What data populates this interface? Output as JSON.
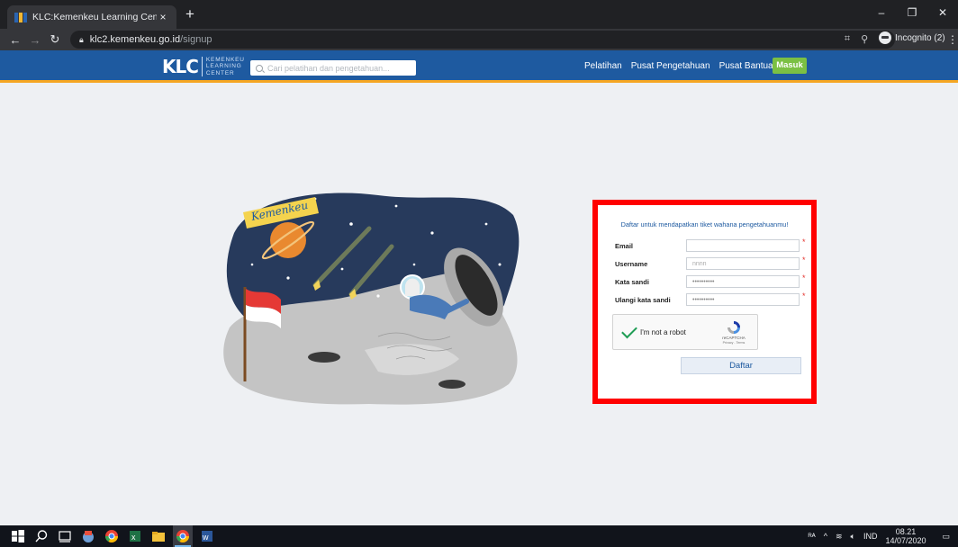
{
  "browser": {
    "tab_title": "KLC:Kemenkeu Learning Center",
    "tab_close": "×",
    "new_tab": "+",
    "url_host": "klc2.kemenkeu.go.id",
    "url_path": "/signup",
    "incognito_label": "Incognito (2)",
    "window_controls": {
      "minimize": "–",
      "restore": "❐",
      "close": "✕"
    }
  },
  "site": {
    "logo_mark": "KLC",
    "logo_lines": [
      "KEMENKEU",
      "LEARNING",
      "CENTER"
    ],
    "search_placeholder": "Cari pelatihan dan pengetahuan...",
    "nav": [
      "Pelatihan",
      "Pusat Pengetahuan",
      "Pusat Bantuan"
    ],
    "login_button": "Masuk"
  },
  "illustration": {
    "banner_text": "Kemenkeu"
  },
  "signup_form": {
    "heading": "Daftar untuk mendapatkan tiket wahana pengetahuanmu!",
    "fields": [
      {
        "label": "Email",
        "value": "",
        "placeholder": ""
      },
      {
        "label": "Username",
        "value": "",
        "placeholder": "nnnn"
      },
      {
        "label": "Kata sandi",
        "value": "••••••••••",
        "placeholder": ""
      },
      {
        "label": "Ulangi kata sandi",
        "value": "••••••••••",
        "placeholder": ""
      }
    ],
    "required_marker": "*",
    "captcha_label": "I'm not a robot",
    "captcha_brand": "reCAPTCHA",
    "captcha_terms": "Privacy - Terms",
    "submit_label": "Daftar"
  },
  "taskbar": {
    "language": "IND",
    "time": "08.21",
    "date": "14/07/2020"
  },
  "colors": {
    "brand_blue": "#1e5aa0",
    "accent_orange": "#f5a623",
    "login_green": "#7bc043",
    "highlight_red": "#ff0000"
  }
}
